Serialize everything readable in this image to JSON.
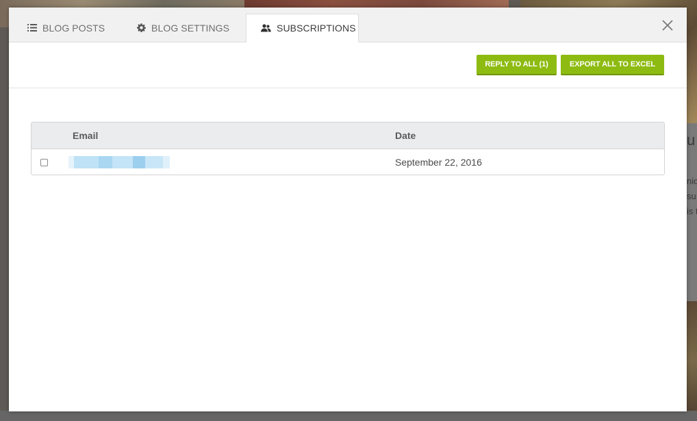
{
  "tabs": [
    {
      "label": "BLOG POSTS",
      "icon": "list-icon",
      "active": false
    },
    {
      "label": "BLOG SETTINGS",
      "icon": "gear-icon",
      "active": false
    },
    {
      "label": "SUBSCRIPTIONS",
      "icon": "users-icon",
      "active": true
    }
  ],
  "close_icon": "close-icon",
  "toolbar": {
    "reply_label": "REPLY TO ALL (1)",
    "export_label": "EXPORT ALL TO EXCEL"
  },
  "table": {
    "columns": [
      "Email",
      "Date"
    ],
    "rows": [
      {
        "email": "",
        "date": "September 22, 2016",
        "checked": false
      }
    ]
  },
  "background": {
    "text_lines": [
      "u",
      "nic",
      "su",
      "is t"
    ]
  },
  "colors": {
    "accent_green": "#8dbb12",
    "tabbar_bg": "#f1f1f1",
    "table_header_bg": "#ebecee"
  }
}
